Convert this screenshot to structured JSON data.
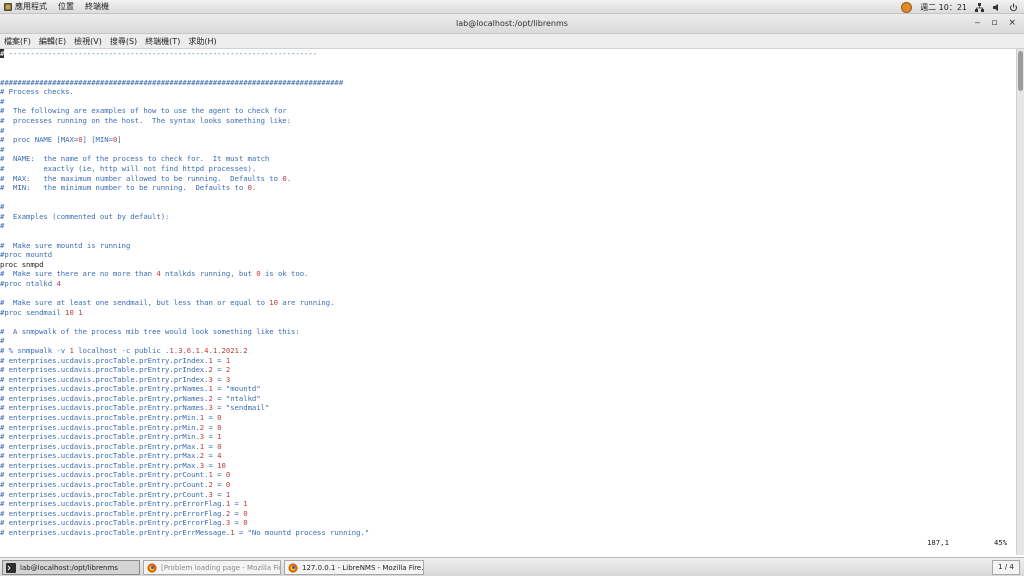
{
  "topbar": {
    "apps_label": "應用程式",
    "places_label": "位置",
    "terminal_label": "終端機",
    "clock": "週二 10：21"
  },
  "window": {
    "title": "lab@localhost:/opt/librenms",
    "minimize_glyph": "‒",
    "maximize_glyph": "▫",
    "close_glyph": "×"
  },
  "menubar": {
    "items": [
      "檔案(F)",
      "編輯(E)",
      "檢視(V)",
      "搜尋(S)",
      "終端機(T)",
      "求助(H)"
    ]
  },
  "terminal": {
    "lines": [
      "# -----------------------------------------------------------------------",
      "",
      "",
      "###############################################################################",
      "# Process checks.",
      "#",
      "#  The following are examples of how to use the agent to check for",
      "#  processes running on the host.  The syntax looks something like:",
      "#",
      "#  proc NAME [MAX=0] [MIN=0]",
      "#",
      "#  NAME:  the name of the process to check for.  It must match",
      "#         exactly (ie, http will not find httpd processes).",
      "#  MAX:   the maximum number allowed to be running.  Defaults to 0.",
      "#  MIN:   the minimum number to be running.  Defaults to 0.",
      "",
      "#",
      "#  Examples (commented out by default):",
      "#",
      "",
      "#  Make sure mountd is running",
      "#proc mountd",
      "proc snmpd",
      "#  Make sure there are no more than 4 ntalkds running, but 0 is ok too.",
      "#proc ntalkd 4",
      "",
      "#  Make sure at least one sendmail, but less than or equal to 10 are running.",
      "#proc sendmail 10 1",
      "",
      "#  A snmpwalk of the process mib tree would look something like this:",
      "#",
      "# % snmpwalk -v 1 localhost -c public .1.3.6.1.4.1.2021.2",
      "# enterprises.ucdavis.procTable.prEntry.prIndex.1 = 1",
      "# enterprises.ucdavis.procTable.prEntry.prIndex.2 = 2",
      "# enterprises.ucdavis.procTable.prEntry.prIndex.3 = 3",
      "# enterprises.ucdavis.procTable.prEntry.prNames.1 = \"mountd\"",
      "# enterprises.ucdavis.procTable.prEntry.prNames.2 = \"ntalkd\"",
      "# enterprises.ucdavis.procTable.prEntry.prNames.3 = \"sendmail\"",
      "# enterprises.ucdavis.procTable.prEntry.prMin.1 = 0",
      "# enterprises.ucdavis.procTable.prEntry.prMin.2 = 0",
      "# enterprises.ucdavis.procTable.prEntry.prMin.3 = 1",
      "# enterprises.ucdavis.procTable.prEntry.prMax.1 = 0",
      "# enterprises.ucdavis.procTable.prEntry.prMax.2 = 4",
      "# enterprises.ucdavis.procTable.prEntry.prMax.3 = 10",
      "# enterprises.ucdavis.procTable.prEntry.prCount.1 = 0",
      "# enterprises.ucdavis.procTable.prEntry.prCount.2 = 0",
      "# enterprises.ucdavis.procTable.prEntry.prCount.3 = 1",
      "# enterprises.ucdavis.procTable.prEntry.prErrorFlag.1 = 1",
      "# enterprises.ucdavis.procTable.prEntry.prErrorFlag.2 = 0",
      "# enterprises.ucdavis.procTable.prEntry.prErrorFlag.3 = 0",
      "# enterprises.ucdavis.procTable.prEntry.prErrMessage.1 = \"No mountd process running.\""
    ],
    "cursor_position": "187,1",
    "scroll_percent": "45%",
    "colors": {
      "comment": "#3b6db3",
      "code": "#1a1a1a",
      "number": "#c23a3a"
    }
  },
  "taskbar": {
    "tasks": [
      {
        "label": "lab@localhost:/opt/librenms",
        "icon": "terminal-icon",
        "active": true
      },
      {
        "label": "[Problem loading page - Mozilla Fire…",
        "icon": "firefox-icon",
        "active": false
      },
      {
        "label": "127.0.0.1 - LibreNMS - Mozilla Fire…",
        "icon": "firefox-icon",
        "active": false
      }
    ],
    "workspace": "1 / 4"
  }
}
